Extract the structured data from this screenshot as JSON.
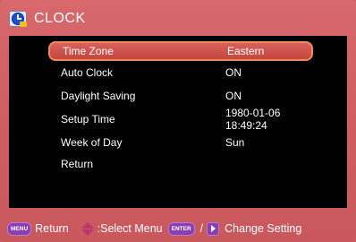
{
  "header": {
    "title": "CLOCK",
    "icon": "clock-icon"
  },
  "menu": {
    "items": [
      {
        "label": "Time Zone",
        "value": "Eastern"
      },
      {
        "label": "Auto Clock",
        "value": "ON"
      },
      {
        "label": "Daylight Saving",
        "value": "ON"
      },
      {
        "label": "Setup Time",
        "value": "1980-01-06 18:49:24"
      },
      {
        "label": "Week of Day",
        "value": "Sun"
      },
      {
        "label": "Return",
        "value": ""
      }
    ],
    "selected_index": 0
  },
  "footer": {
    "menu_key": "MENU",
    "return_text": "Return",
    "select_text": ":Select Menu",
    "enter_key": "ENTER",
    "slash": "/",
    "change_text": "Change Setting"
  },
  "colors": {
    "background": "#cf5f63",
    "panel": "#000000",
    "selection": "#c4463f",
    "key": "#8a3fb0"
  }
}
